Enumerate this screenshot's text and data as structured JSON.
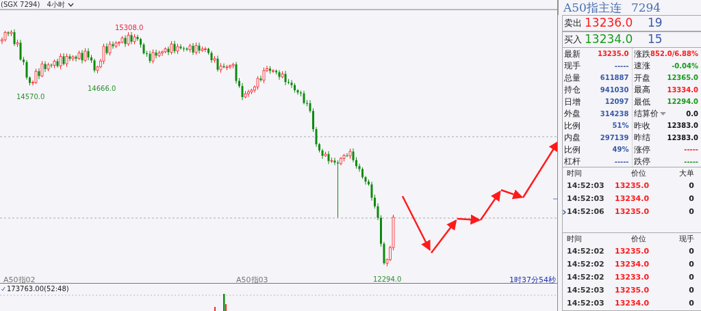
{
  "header": {
    "symbol": "(SGX 7294)",
    "period": "4小时"
  },
  "chart": {
    "price_labels": [
      {
        "text": "15308.0",
        "kind": "high"
      },
      {
        "text": "14570.0",
        "kind": "low"
      },
      {
        "text": "14666.0",
        "kind": "low"
      },
      {
        "text": "12294.0",
        "kind": "low"
      }
    ],
    "axis_labels": [
      "A50指02",
      "A50指03"
    ],
    "countdown": "1时37分54秒"
  },
  "volume": {
    "reading": "173763.00(52:48)"
  },
  "quote": {
    "title": "A50指主连",
    "code": "7294",
    "ask": {
      "label": "卖出",
      "price": "13236.0",
      "size": "19",
      "color": "#ff1a1a"
    },
    "bid": {
      "label": "买入",
      "price": "13234.0",
      "size": "15",
      "color": "#199a19"
    },
    "left_stats": [
      {
        "label": "最新",
        "value": "13235.0",
        "color": "#ff1a1a"
      },
      {
        "label": "现手",
        "value": "-----",
        "color": "#3a5aa8"
      },
      {
        "label": "总量",
        "value": "611887",
        "color": "#3a5aa8"
      },
      {
        "label": "持仓",
        "value": "941030",
        "color": "#3a5aa8"
      },
      {
        "label": "日增",
        "value": "12097",
        "color": "#3a5aa8"
      },
      {
        "label": "外盘",
        "value": "314238",
        "color": "#3a5aa8"
      },
      {
        "label": "比例",
        "value": "51%",
        "color": "#3a5aa8"
      },
      {
        "label": "内盘",
        "value": "297139",
        "color": "#3a5aa8"
      },
      {
        "label": "比例",
        "value": "49%",
        "color": "#3a5aa8"
      },
      {
        "label": "杠杆",
        "value": "-----",
        "color": "#3a5aa8"
      }
    ],
    "right_stats": [
      {
        "label": "涨跌",
        "value": "852.0/6.88%",
        "color": "#ff1a1a",
        "kind": "plain"
      },
      {
        "label": "速涨",
        "value": "-0.04%",
        "color": "#199a19",
        "kind": "plain"
      },
      {
        "label": "开盘",
        "value": "12365.0",
        "color": "#199a19",
        "kind": "plain"
      },
      {
        "label": "最高",
        "value": "13334.0",
        "color": "#ff1a1a",
        "kind": "plain"
      },
      {
        "label": "最低",
        "value": "12294.0",
        "color": "#199a19",
        "kind": "plain"
      },
      {
        "label": "结算价",
        "value": "0.0",
        "color": "#111111",
        "kind": "dropdown"
      },
      {
        "label": "昨收",
        "value": "12383.0",
        "color": "#111111",
        "kind": "plain"
      },
      {
        "label": "昨结",
        "value": "12383.0",
        "color": "#111111",
        "kind": "plain"
      },
      {
        "label": "涨停",
        "value": "-----",
        "color": "#ff1a1a",
        "kind": "plain"
      },
      {
        "label": "跌停",
        "value": "-----",
        "color": "#199a19",
        "kind": "plain"
      }
    ]
  },
  "big_orders": {
    "columns": [
      "时间",
      "价位",
      "大单"
    ],
    "rows": [
      {
        "time": "14:52:03",
        "price": "13235.0",
        "amount": "0",
        "selected": false
      },
      {
        "time": "14:52:03",
        "price": "13234.0",
        "amount": "0",
        "selected": false
      },
      {
        "time": "14:52:06",
        "price": "13235.0",
        "amount": "0",
        "selected": true
      }
    ]
  },
  "trades": {
    "columns": [
      "时间",
      "价位",
      "现手"
    ],
    "rows": [
      {
        "time": "14:52:02",
        "price": "13235.0",
        "amount": "0"
      },
      {
        "time": "14:52:02",
        "price": "13234.0",
        "amount": "0"
      },
      {
        "time": "14:52:02",
        "price": "13233.0",
        "amount": "0"
      },
      {
        "time": "14:52:03",
        "price": "13235.0",
        "amount": "0"
      },
      {
        "time": "14:52:03",
        "price": "13234.0",
        "amount": "0"
      }
    ]
  }
}
